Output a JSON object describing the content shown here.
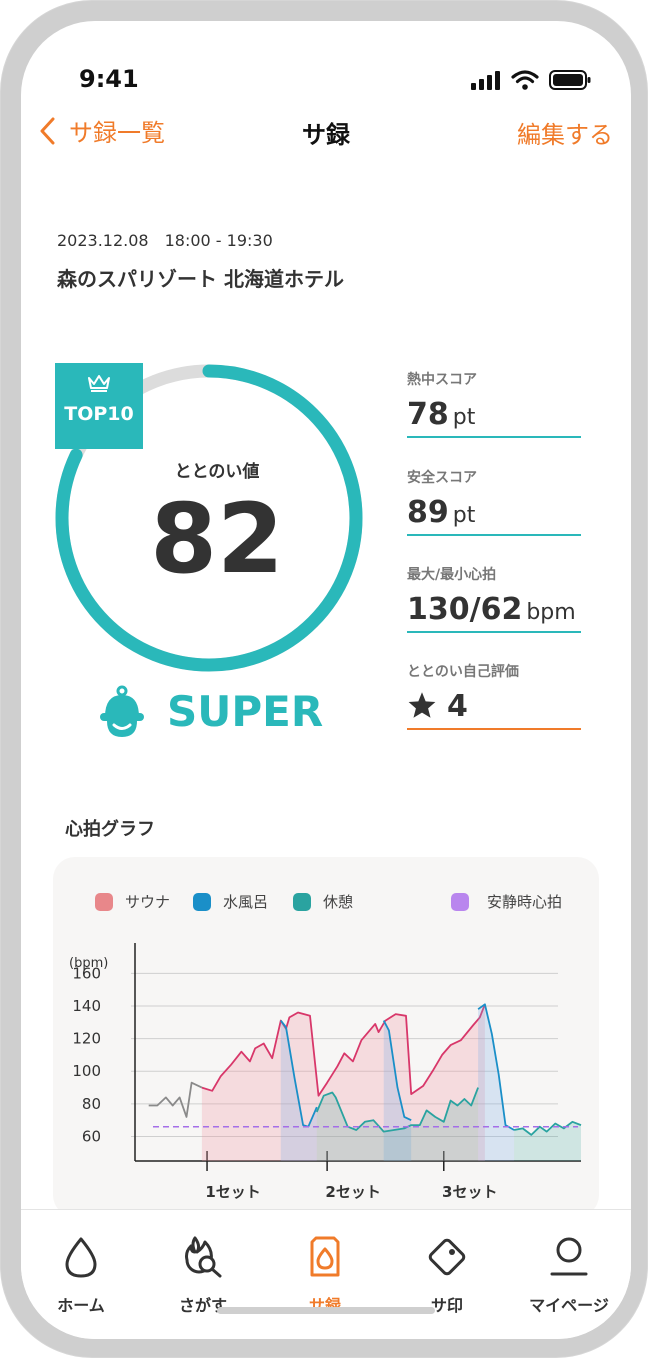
{
  "status": {
    "time": "9:41"
  },
  "nav": {
    "back_label": "サ録一覧",
    "title": "サ録",
    "edit_label": "編集する"
  },
  "session": {
    "date": "2023.12.08　18:00 - 19:30",
    "venue": "森のスパリゾート 北海道ホテル"
  },
  "score": {
    "badge": "TOP10",
    "label": "ととのい値",
    "value": "82",
    "rank": "SUPER",
    "progress": 0.82
  },
  "metrics": [
    {
      "label": "熱中スコア",
      "value": "78",
      "unit": "pt"
    },
    {
      "label": "安全スコア",
      "value": "89",
      "unit": "pt"
    },
    {
      "label": "最大/最小心拍",
      "value": "130/62",
      "unit": "bpm"
    },
    {
      "label": "ととのい自己評価",
      "value": "4"
    }
  ],
  "graph": {
    "title": "心拍グラフ"
  },
  "colors": {
    "accent": "#f07b2a",
    "teal": "#2ab8ba",
    "sauna": "#e8878a",
    "water": "#1a8fc8",
    "rest": "#2aa3a0",
    "resting": "#b986ee"
  },
  "chart_data": {
    "type": "line",
    "ylabel": "(bpm)",
    "y_ticks": [
      160,
      140,
      120,
      100,
      80,
      60
    ],
    "ylim": [
      45,
      170
    ],
    "xlim": [
      0,
      26
    ],
    "x_ticks": [
      {
        "x": 4.2,
        "label": "1セット"
      },
      {
        "x": 11.2,
        "label": "2セット"
      },
      {
        "x": 18.0,
        "label": "3セット"
      }
    ],
    "legend": [
      "サウナ",
      "水風呂",
      "休憩",
      "安静時心拍"
    ],
    "resting_hr": 66,
    "series": [
      {
        "name": "サウナ",
        "x": [
          3.9,
          4.5,
          5.0,
          5.6,
          6.2,
          6.7,
          7.0,
          7.5,
          8.0,
          8.5,
          8.8,
          9.0,
          9.5,
          10.2,
          10.7,
          11.2,
          11.8,
          12.2,
          12.7,
          13.2,
          13.6,
          14.0,
          14.2,
          14.6,
          15.2,
          15.8,
          16.1,
          16.8,
          17.4,
          17.9,
          18.4,
          19.0,
          19.7,
          20.1,
          20.4
        ],
        "y": [
          90,
          88,
          97,
          104,
          112,
          106,
          114,
          117,
          108,
          131,
          126,
          133,
          136,
          134,
          85,
          93,
          103,
          111,
          106,
          119,
          124,
          129,
          124,
          131,
          135,
          134,
          86,
          91,
          101,
          110,
          116,
          119,
          128,
          133,
          141
        ]
      },
      {
        "name": "水風呂",
        "x": [
          8.5,
          8.8,
          9.3,
          9.8,
          10.1,
          10.6,
          14.5,
          14.8,
          15.3,
          15.7,
          16.1,
          20.0,
          20.4,
          20.8,
          21.2,
          21.6,
          22.1
        ],
        "y": [
          131,
          127,
          96,
          67,
          66,
          78,
          131,
          125,
          90,
          72,
          70,
          138,
          141,
          123,
          98,
          67,
          64
        ]
      },
      {
        "name": "休憩",
        "x": [
          0.8,
          1.3,
          1.8,
          2.2,
          2.6,
          3.0,
          3.3,
          3.9,
          10.6,
          11.0,
          11.5,
          11.7,
          12.4,
          12.9,
          13.4,
          13.9,
          14.5,
          15.7,
          16.1,
          16.6,
          17.0,
          17.5,
          18.0,
          18.4,
          18.8,
          19.2,
          19.6,
          20.0,
          22.1,
          22.6,
          23.1,
          23.6,
          24.0,
          24.5,
          25.0,
          25.5,
          26.0
        ],
        "y": [
          79,
          79,
          84,
          79,
          84,
          72,
          93,
          90,
          75,
          85,
          87,
          84,
          66,
          64,
          69,
          70,
          63,
          65,
          67,
          67,
          76,
          72,
          69,
          82,
          79,
          83,
          79,
          90,
          64,
          65,
          61,
          66,
          63,
          68,
          65,
          69,
          67
        ]
      }
    ]
  }
}
